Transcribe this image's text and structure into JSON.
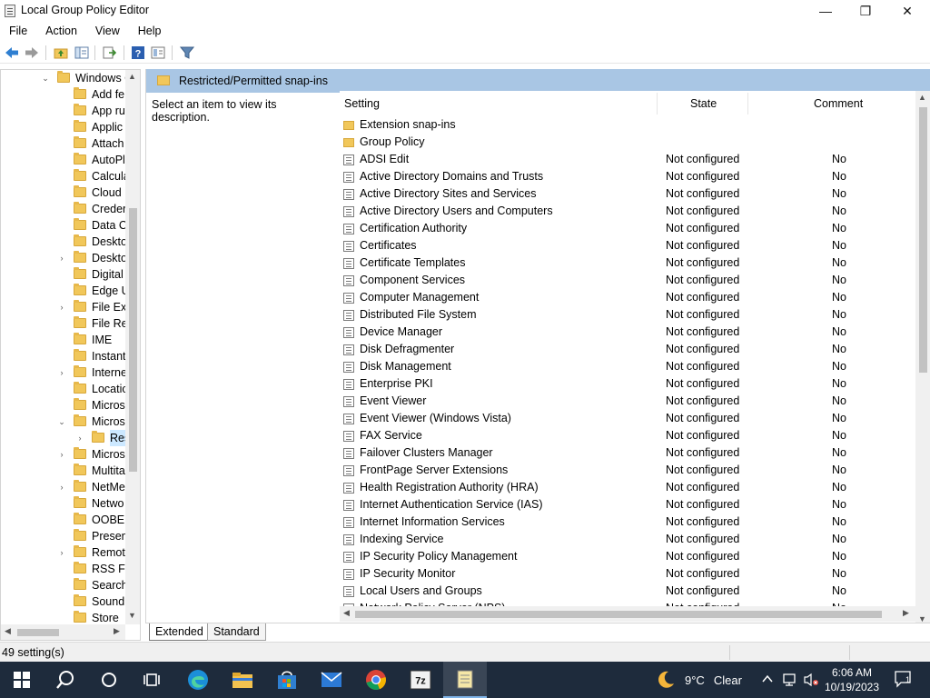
{
  "window": {
    "title": "Local Group Policy Editor",
    "minimize": "—",
    "restore": "❐",
    "close": "✕"
  },
  "menu": [
    "File",
    "Action",
    "View",
    "Help"
  ],
  "toolbar": {
    "icons": [
      "back-arrow-icon",
      "forward-arrow-icon",
      "up-folder-icon",
      "show-hide-tree-icon",
      "export-list-icon",
      "help-icon",
      "properties-icon",
      "filter-icon"
    ]
  },
  "tree": {
    "items": [
      {
        "label": "Windows C",
        "expander": "⌄"
      },
      {
        "label": "Add fe",
        "expander": ""
      },
      {
        "label": "App ru",
        "expander": ""
      },
      {
        "label": "Applic",
        "expander": ""
      },
      {
        "label": "Attach",
        "expander": ""
      },
      {
        "label": "AutoPl",
        "expander": ""
      },
      {
        "label": "Calcula",
        "expander": ""
      },
      {
        "label": "Cloud",
        "expander": ""
      },
      {
        "label": "Creder",
        "expander": ""
      },
      {
        "label": "Data C",
        "expander": ""
      },
      {
        "label": "Deskto",
        "expander": ""
      },
      {
        "label": "Deskto",
        "expander": "›"
      },
      {
        "label": "Digital",
        "expander": ""
      },
      {
        "label": "Edge U",
        "expander": ""
      },
      {
        "label": "File Exp",
        "expander": "›"
      },
      {
        "label": "File Re",
        "expander": ""
      },
      {
        "label": "IME",
        "expander": ""
      },
      {
        "label": "Instant",
        "expander": ""
      },
      {
        "label": "Interne",
        "expander": "›"
      },
      {
        "label": "Locatio",
        "expander": ""
      },
      {
        "label": "Micros",
        "expander": ""
      },
      {
        "label": "Micros",
        "expander": "⌄"
      },
      {
        "label": "Res",
        "expander": "›"
      },
      {
        "label": "Micros",
        "expander": "›"
      },
      {
        "label": "Multita",
        "expander": ""
      },
      {
        "label": "NetMe",
        "expander": "›"
      },
      {
        "label": "Netwo",
        "expander": ""
      },
      {
        "label": "OOBE",
        "expander": ""
      },
      {
        "label": "Presen",
        "expander": ""
      },
      {
        "label": "Remot",
        "expander": "›"
      },
      {
        "label": "RSS Fe",
        "expander": ""
      },
      {
        "label": "Search",
        "expander": ""
      },
      {
        "label": "Sound",
        "expander": ""
      },
      {
        "label": "Store",
        "expander": ""
      }
    ]
  },
  "right": {
    "header_title": "Restricted/Permitted snap-ins",
    "description": "Select an item to view its description.",
    "columns": {
      "setting": "Setting",
      "state": "State",
      "comment": "Comment"
    },
    "rows": [
      {
        "type": "folder",
        "name": "Extension snap-ins",
        "state": "",
        "comment": ""
      },
      {
        "type": "folder",
        "name": "Group Policy",
        "state": "",
        "comment": ""
      },
      {
        "type": "policy",
        "name": "ADSI Edit",
        "state": "Not configured",
        "comment": "No"
      },
      {
        "type": "policy",
        "name": "Active Directory Domains and Trusts",
        "state": "Not configured",
        "comment": "No"
      },
      {
        "type": "policy",
        "name": "Active Directory Sites and Services",
        "state": "Not configured",
        "comment": "No"
      },
      {
        "type": "policy",
        "name": "Active Directory Users and Computers",
        "state": "Not configured",
        "comment": "No"
      },
      {
        "type": "policy",
        "name": "Certification Authority",
        "state": "Not configured",
        "comment": "No"
      },
      {
        "type": "policy",
        "name": "Certificates",
        "state": "Not configured",
        "comment": "No"
      },
      {
        "type": "policy",
        "name": "Certificate Templates",
        "state": "Not configured",
        "comment": "No"
      },
      {
        "type": "policy",
        "name": "Component Services",
        "state": "Not configured",
        "comment": "No"
      },
      {
        "type": "policy",
        "name": "Computer Management",
        "state": "Not configured",
        "comment": "No"
      },
      {
        "type": "policy",
        "name": "Distributed File System",
        "state": "Not configured",
        "comment": "No"
      },
      {
        "type": "policy",
        "name": "Device Manager",
        "state": "Not configured",
        "comment": "No"
      },
      {
        "type": "policy",
        "name": "Disk Defragmenter",
        "state": "Not configured",
        "comment": "No"
      },
      {
        "type": "policy",
        "name": "Disk Management",
        "state": "Not configured",
        "comment": "No"
      },
      {
        "type": "policy",
        "name": "Enterprise PKI",
        "state": "Not configured",
        "comment": "No"
      },
      {
        "type": "policy",
        "name": "Event Viewer",
        "state": "Not configured",
        "comment": "No"
      },
      {
        "type": "policy",
        "name": "Event Viewer (Windows Vista)",
        "state": "Not configured",
        "comment": "No"
      },
      {
        "type": "policy",
        "name": "FAX Service",
        "state": "Not configured",
        "comment": "No"
      },
      {
        "type": "policy",
        "name": "Failover Clusters Manager",
        "state": "Not configured",
        "comment": "No"
      },
      {
        "type": "policy",
        "name": "FrontPage Server Extensions",
        "state": "Not configured",
        "comment": "No"
      },
      {
        "type": "policy",
        "name": "Health Registration Authority (HRA)",
        "state": "Not configured",
        "comment": "No"
      },
      {
        "type": "policy",
        "name": "Internet Authentication Service (IAS)",
        "state": "Not configured",
        "comment": "No"
      },
      {
        "type": "policy",
        "name": "Internet Information Services",
        "state": "Not configured",
        "comment": "No"
      },
      {
        "type": "policy",
        "name": "Indexing Service",
        "state": "Not configured",
        "comment": "No"
      },
      {
        "type": "policy",
        "name": "IP Security Policy Management",
        "state": "Not configured",
        "comment": "No"
      },
      {
        "type": "policy",
        "name": "IP Security Monitor",
        "state": "Not configured",
        "comment": "No"
      },
      {
        "type": "policy",
        "name": "Local Users and Groups",
        "state": "Not configured",
        "comment": "No"
      },
      {
        "type": "policy",
        "name": "Network Policy Server (NPS)",
        "state": "Not configured",
        "comment": "No"
      }
    ]
  },
  "tabs": {
    "extended": "Extended",
    "standard": "Standard"
  },
  "status": {
    "text": "49 setting(s)"
  },
  "taskbar": {
    "weather_temp": "9°C",
    "weather_desc": "Clear",
    "time": "6:06 AM",
    "date": "10/19/2023",
    "notification_count": "1",
    "apps": [
      "start-windows-icon",
      "search-icon",
      "cortana-icon",
      "task-view-icon",
      "edge-icon",
      "file-explorer-icon",
      "store-icon",
      "mail-icon",
      "chrome-icon",
      "7zip-icon",
      "notepad-icon"
    ]
  },
  "colors": {
    "header_band": "#a9c6e4",
    "taskbar": "#1e2b3c",
    "folder": "#f1c75a",
    "selection": "#cce8ff"
  }
}
